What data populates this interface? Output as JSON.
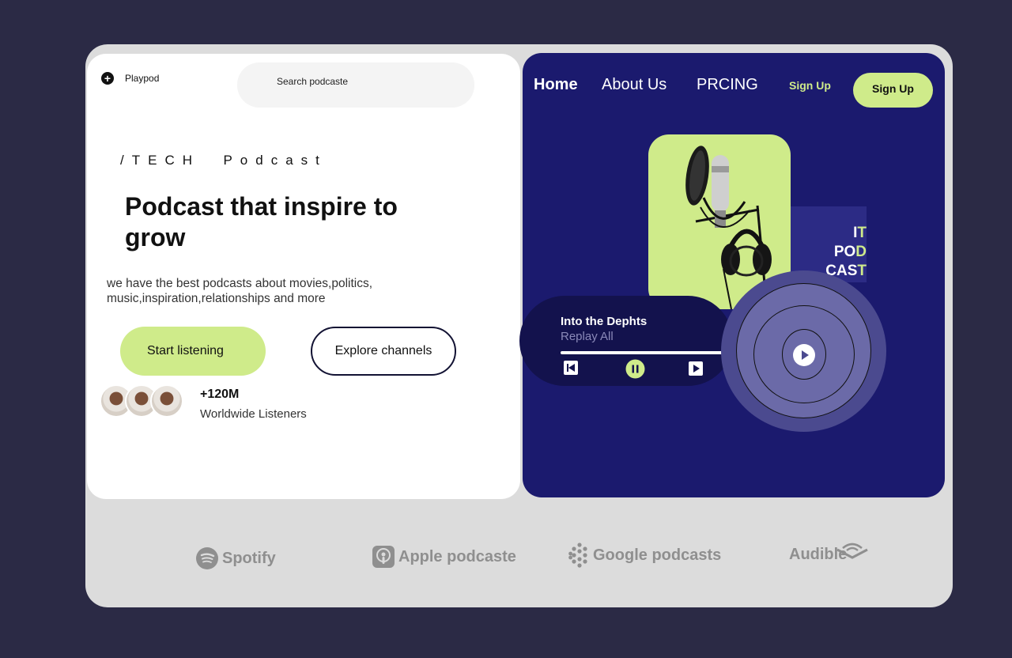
{
  "brand": {
    "name": "Playpod",
    "icon": "plus-icon"
  },
  "search": {
    "placeholder": "Search podcaste"
  },
  "hero": {
    "eyebrow": "/TECH  Podcast",
    "headline": "Podcast that inspire to grow",
    "description": "we have the best podcasts about movies,politics, music,inspiration,relationships and more",
    "primary_cta": "Start listening",
    "secondary_cta": "Explore channels",
    "stat_value": "+120M",
    "stat_label": "Worldwide Listeners"
  },
  "nav": {
    "home": "Home",
    "about": "About Us",
    "pricing": "PRCING",
    "signup_link": "Sign Up",
    "signup_button": "Sign Up"
  },
  "cover_badge": {
    "line1": "IT",
    "line2": "POD",
    "line3": "CAST"
  },
  "player": {
    "title": "Into  the Dephts",
    "artist": "Replay All",
    "progress": 1.0
  },
  "partners": [
    "Spotify",
    "Apple podcaste",
    "Google podcasts",
    "Audible"
  ],
  "colors": {
    "accent": "#cfeb8a",
    "navy": "#1b1a6e",
    "background": "#2b2a45",
    "frame": "#dcdcdc"
  }
}
